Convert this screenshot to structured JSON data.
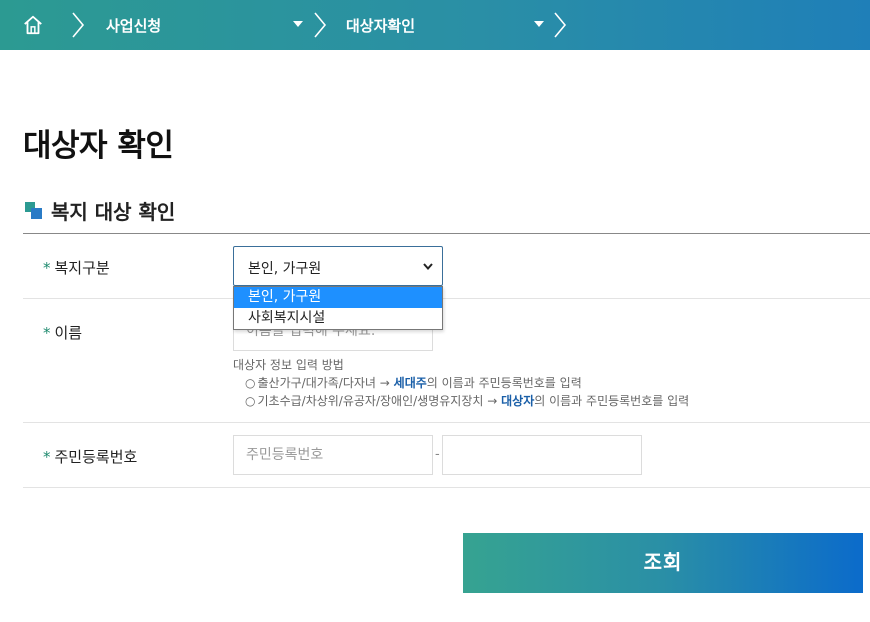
{
  "breadcrumb": {
    "home_icon": "home-icon",
    "items": [
      {
        "label": "사업신청"
      },
      {
        "label": "대상자확인"
      }
    ]
  },
  "page": {
    "title": "대상자 확인"
  },
  "section": {
    "title": "복지 대상 확인"
  },
  "form": {
    "required_mark": "*",
    "welfare_type": {
      "label": "복지구분",
      "selected": "본인, 가구원",
      "options": [
        "본인, 가구원",
        "사회복지시설"
      ]
    },
    "name": {
      "label": "이름",
      "placeholder": "이름을 입력해 주세요."
    },
    "guide": {
      "title": "대상자 정보 입력 방법",
      "line1": {
        "bullet": "○",
        "prefix": "출산가구/대가족/다자녀 → ",
        "highlight": "세대주",
        "suffix": "의 이름과 주민등록번호를 입력"
      },
      "line2": {
        "bullet": "○",
        "prefix": "기초수급/차상위/유공자/장애인/생명유지장치 → ",
        "highlight": "대상자",
        "suffix": "의 이름과 주민등록번호를 입력"
      }
    },
    "rrn": {
      "label": "주민등록번호",
      "placeholder_front": "주민등록번호",
      "separator": "-",
      "placeholder_back": ""
    },
    "submit_label": "조회"
  },
  "colors": {
    "accent_teal": "#2c9a92",
    "accent_blue": "#0b6bcb",
    "highlight_text": "#1a5fa8",
    "selected_option": "#1e90ff"
  }
}
